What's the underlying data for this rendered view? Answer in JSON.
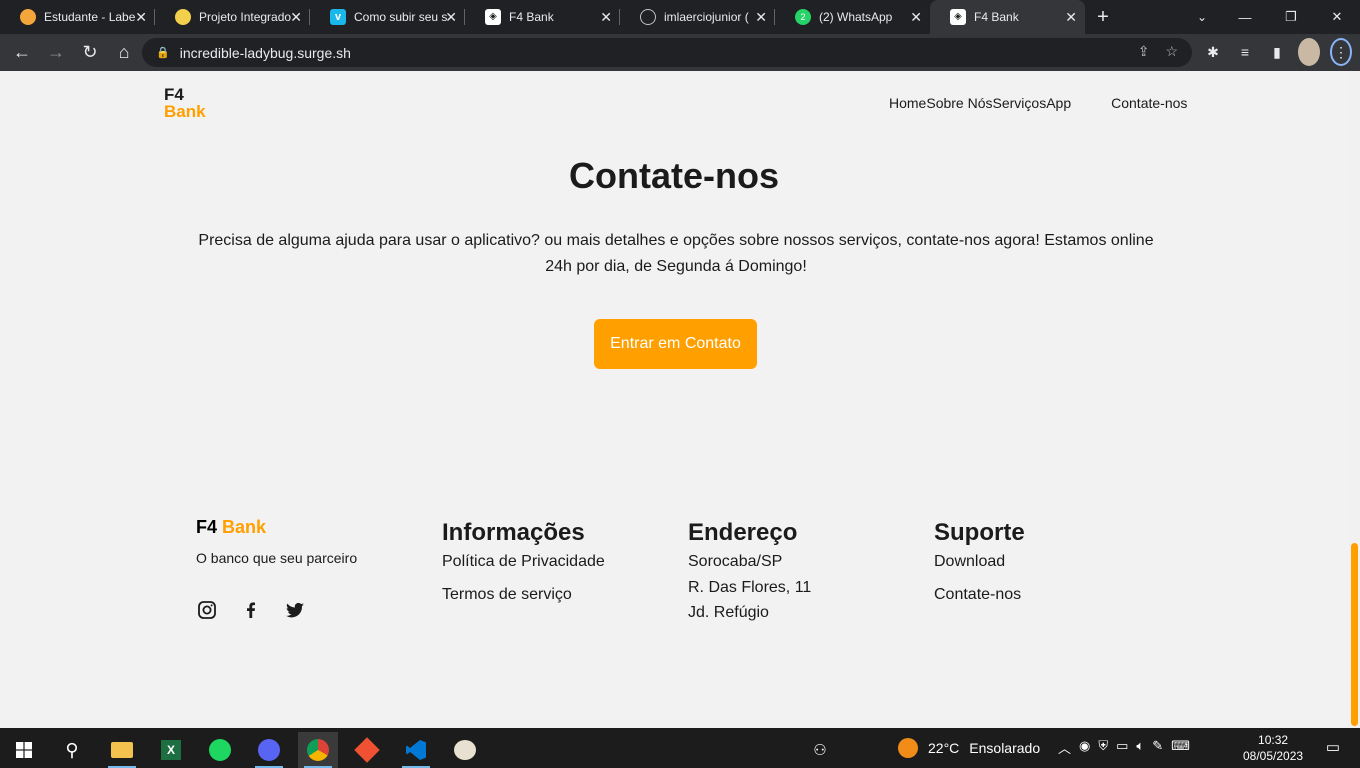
{
  "browser": {
    "tabs": [
      {
        "title": "Estudante - Labe",
        "favicon_color": "#f4a63a"
      },
      {
        "title": "Projeto Integrado",
        "favicon_color": "#f2d04d"
      },
      {
        "title": "Como subir seu s",
        "favicon_color": "#1ab7ea"
      },
      {
        "title": "F4 Bank",
        "favicon_color": "#ffffff"
      },
      {
        "title": "imlaerciojunior (",
        "favicon_color": "#202124"
      },
      {
        "title": "(2) WhatsApp",
        "favicon_color": "#25d366"
      },
      {
        "title": "F4 Bank",
        "favicon_color": "#ffffff",
        "active": true
      }
    ],
    "url": "incredible-ladybug.surge.sh"
  },
  "site": {
    "logo_f4": "F4",
    "logo_bank": "Bank",
    "nav": [
      "Home",
      "Sobre Nós",
      "Serviços",
      "App"
    ],
    "nav_contact": "Contate-nos",
    "contact_heading": "Contate-nos",
    "contact_text": "Precisa de alguma ajuda para usar o aplicativo? ou mais detalhes e opções sobre nossos serviços, contate-nos agora! Estamos online 24h por dia, de Segunda á Domingo!",
    "cta_label": "Entrar em Contato",
    "accent_color": "#ff9f00"
  },
  "footer": {
    "brand_f4": "F4",
    "brand_bank": "Bank",
    "tagline": "O banco que seu parceiro",
    "socials": [
      "instagram-icon",
      "facebook-icon",
      "twitter-icon"
    ],
    "info": {
      "heading": "Informações",
      "items": [
        "Política de Privacidade",
        "Termos de serviço"
      ]
    },
    "address": {
      "heading": "Endereço",
      "items": [
        "Sorocaba/SP",
        "R. Das Flores, 11",
        "Jd. Refúgio"
      ]
    },
    "support": {
      "heading": "Suporte",
      "items": [
        "Download",
        "Contate-nos"
      ]
    }
  },
  "taskbar": {
    "weather_temp": "22°C",
    "weather_text": "Ensolarado",
    "time": "10:32",
    "date": "08/05/2023"
  }
}
